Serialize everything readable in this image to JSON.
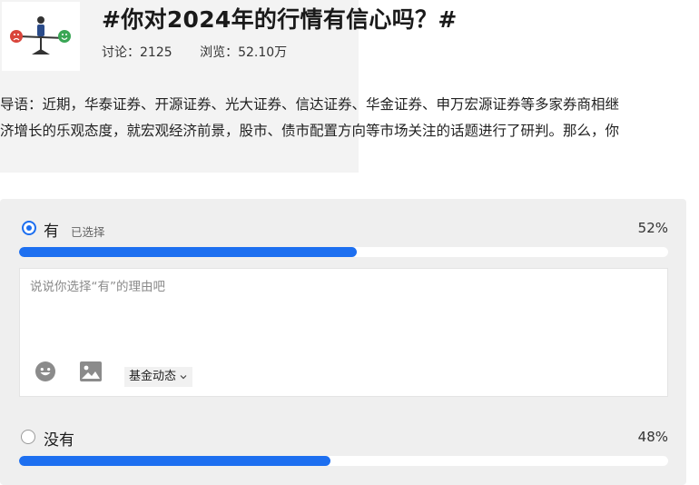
{
  "header": {
    "title": "#你对2024年的行情有信心吗？#",
    "discuss_label": "讨论：2125",
    "views_label": "浏览：52.10万"
  },
  "intro": {
    "line1": "导语：近期，华泰证券、开源证券、光大证券、信达证券、华金证券、申万宏源证券等多家券商相继",
    "line2": "济增长的乐观态度，就宏观经济前景，股市、债市配置方向等市场关注的话题进行了研判。那么，你"
  },
  "poll": {
    "options": [
      {
        "label": "有",
        "selected_tag": "已选择",
        "percent_text": "52%",
        "percent": 52,
        "selected": true
      },
      {
        "label": "没有",
        "percent_text": "48%",
        "percent": 48,
        "selected": false
      }
    ],
    "reason_placeholder": "说说你选择“有”的理由吧",
    "tag_select": "基金动态"
  },
  "icons": {
    "emoji": "smile-icon",
    "image": "image-icon",
    "chevron": "chevron-down-icon"
  },
  "colors": {
    "accent": "#1d6ff0",
    "panel_bg": "#efefef",
    "header_bg": "#f3f3f3"
  }
}
